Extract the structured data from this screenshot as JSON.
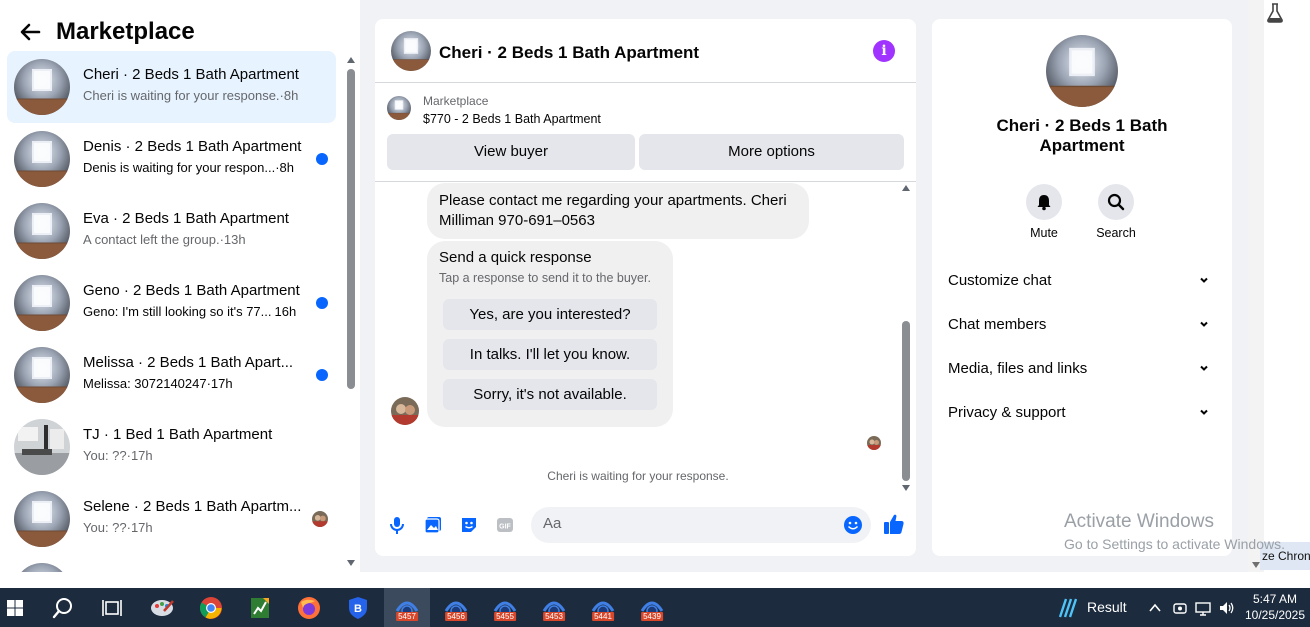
{
  "left_panel": {
    "title": "Marketplace",
    "conversations": [
      {
        "name": "Cheri · 2 Beds 1 Bath Apartment",
        "message": "Cheri is waiting for your response.",
        "time": "·8h",
        "active": true,
        "unread": false
      },
      {
        "name": "Denis · 2 Beds 1 Bath Apartment",
        "message": "Denis is waiting for your respon...",
        "time": "·8h",
        "active": false,
        "unread": true
      },
      {
        "name": "Eva · 2 Beds 1 Bath Apartment",
        "message": "A contact left the group.",
        "time": "·13h",
        "active": false,
        "unread": false
      },
      {
        "name": "Geno · 2 Beds 1 Bath Apartment",
        "message": "Geno: I'm still looking so it's 77...",
        "time": "16h",
        "active": false,
        "unread": true
      },
      {
        "name": "Melissa · 2 Beds 1 Bath Apart...",
        "message": "Melissa: 3072140247",
        "time": "·17h",
        "active": false,
        "unread": true
      },
      {
        "name": "TJ · 1 Bed 1 Bath Apartment",
        "message": "You: ??",
        "time": "·17h",
        "active": false,
        "unread": false
      },
      {
        "name": "Selene · 2 Beds 1 Bath Apartm...",
        "message": "You: ??",
        "time": "·17h",
        "active": false,
        "unread": false
      }
    ]
  },
  "chat": {
    "title": "Cheri · 2 Beds 1 Bath Apartment",
    "info_icon": "info-icon",
    "marketplace_label": "Marketplace",
    "listing": "$770 - 2 Beds 1 Bath Apartment",
    "view_buyer": "View buyer",
    "more_options": "More options",
    "message": "Please contact me regarding your apartments.  Cheri Milliman 970-691–0563",
    "quick_response": {
      "heading": "Send a quick response",
      "subheading": "Tap a response to send it to the buyer.",
      "options": [
        "Yes, are you interested?",
        "In talks. I'll let you know.",
        "Sorry, it's not available."
      ]
    },
    "waiting_text": "Cheri is waiting for your response.",
    "composer_placeholder": "Aa"
  },
  "details": {
    "name": "Cheri · 2 Beds 1 Bath Apartment",
    "actions": [
      {
        "label": "Mute",
        "icon": "bell-icon"
      },
      {
        "label": "Search",
        "icon": "search-icon"
      }
    ],
    "sections": [
      "Customize chat",
      "Chat members",
      "Media, files and links",
      "Privacy & support"
    ]
  },
  "watermark": {
    "line1": "Activate Windows",
    "line2": "Go to Settings to activate Windows."
  },
  "chrome_peek": "ze Chron",
  "taskbar": {
    "badges": [
      "5457",
      "5456",
      "5455",
      "5453",
      "5441",
      "5439"
    ],
    "result_label": "Result",
    "time": "5:47 AM",
    "date": "10/25/2025"
  },
  "colors": {
    "accent": "#0866ff",
    "info_purple": "#a033ff",
    "active_row": "#e7f3ff",
    "taskbar": "#1c2b3d"
  }
}
